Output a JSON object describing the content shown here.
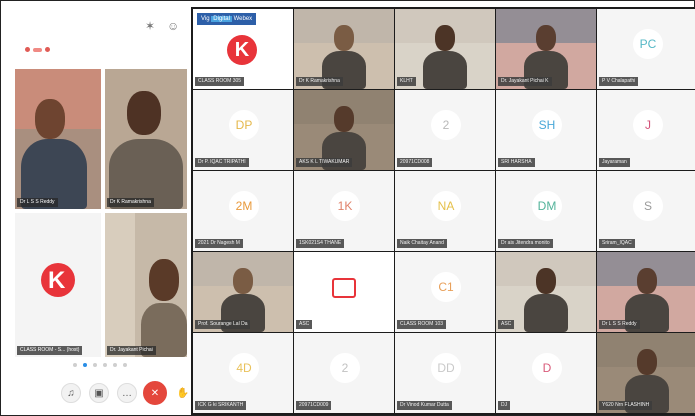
{
  "phone": {
    "top_icons": [
      "bluetooth-icon",
      "person-icon"
    ],
    "tiles": [
      {
        "label": "Dr L S S Reddy"
      },
      {
        "label": "Dr K Ramakrishna"
      },
      {
        "label": "CLASS ROOM - S... (host)"
      },
      {
        "label": "Dr. Jayakant Pichai"
      }
    ],
    "pager_count": 6,
    "pager_active": 1,
    "callbar": [
      "mic-icon",
      "video-icon",
      "more-icon",
      "end-call-icon",
      "hand-icon"
    ]
  },
  "gallery": {
    "badge": {
      "prefix": "Vig",
      "highlight": "Digital",
      "suffix": "Webex"
    },
    "tiles": [
      {
        "type": "logo",
        "label": "CLASS ROOM 305"
      },
      {
        "type": "video",
        "label": "Dr K Ramakrishna"
      },
      {
        "type": "video",
        "label": "KLHT"
      },
      {
        "type": "video",
        "label": "Dr. Jayakant Pichai K"
      },
      {
        "type": "avatar",
        "initials": "PC",
        "color": "#55b8c6",
        "label": "P V Chalapathi"
      },
      {
        "type": "avatar",
        "initials": "DP",
        "color": "#e5b84b",
        "label": "Dr P. IQAC TRIPATHI"
      },
      {
        "type": "video",
        "label": "AKS K L TIWAKUMAR"
      },
      {
        "type": "avatar",
        "initials": "2",
        "color": "#b9b9b9",
        "label": "20971CD008"
      },
      {
        "type": "avatar",
        "initials": "SH",
        "color": "#4aa8d8",
        "label": "SRI HARSHA"
      },
      {
        "type": "avatar",
        "initials": "J",
        "color": "#d4537a",
        "label": "Jayaraman"
      },
      {
        "type": "avatar",
        "initials": "2M",
        "color": "#e99a3c",
        "label": "2021 Dr Nagesh M"
      },
      {
        "type": "avatar",
        "initials": "1K",
        "color": "#e0826a",
        "label": "1SK021S4 THANE"
      },
      {
        "type": "avatar",
        "initials": "NA",
        "color": "#e5c04a",
        "label": "Naik Chaitay Anand"
      },
      {
        "type": "avatar",
        "initials": "DM",
        "color": "#52b39a",
        "label": "Dr ais Jitendra monito"
      },
      {
        "type": "avatar",
        "initials": "S",
        "color": "#9a9a9a",
        "label": "Sriram_IQAC"
      },
      {
        "type": "video",
        "label": "Prof. Sourange Lal Da"
      },
      {
        "type": "logo2",
        "label": "ASC"
      },
      {
        "type": "avatar",
        "initials": "C1",
        "color": "#e8a05a",
        "label": "CLASS ROOM 103"
      },
      {
        "type": "video",
        "label": "ASC"
      },
      {
        "type": "video",
        "label": "Dr L S S Reddy"
      },
      {
        "type": "avatar",
        "initials": "4D",
        "color": "#e9c25c",
        "label": "ICK G ki SRIKANTH"
      },
      {
        "type": "avatar",
        "initials": "2",
        "color": "#c2c2c2",
        "label": "20971CD009"
      },
      {
        "type": "avatar",
        "initials": "DD",
        "color": "#c9c9c9",
        "label": "Dr Vinod Kumar Dutta"
      },
      {
        "type": "avatar",
        "initials": "D",
        "color": "#d95b7a",
        "label": "DJ"
      },
      {
        "type": "video",
        "label": "Y620 Nrn FLASHINH"
      }
    ]
  }
}
